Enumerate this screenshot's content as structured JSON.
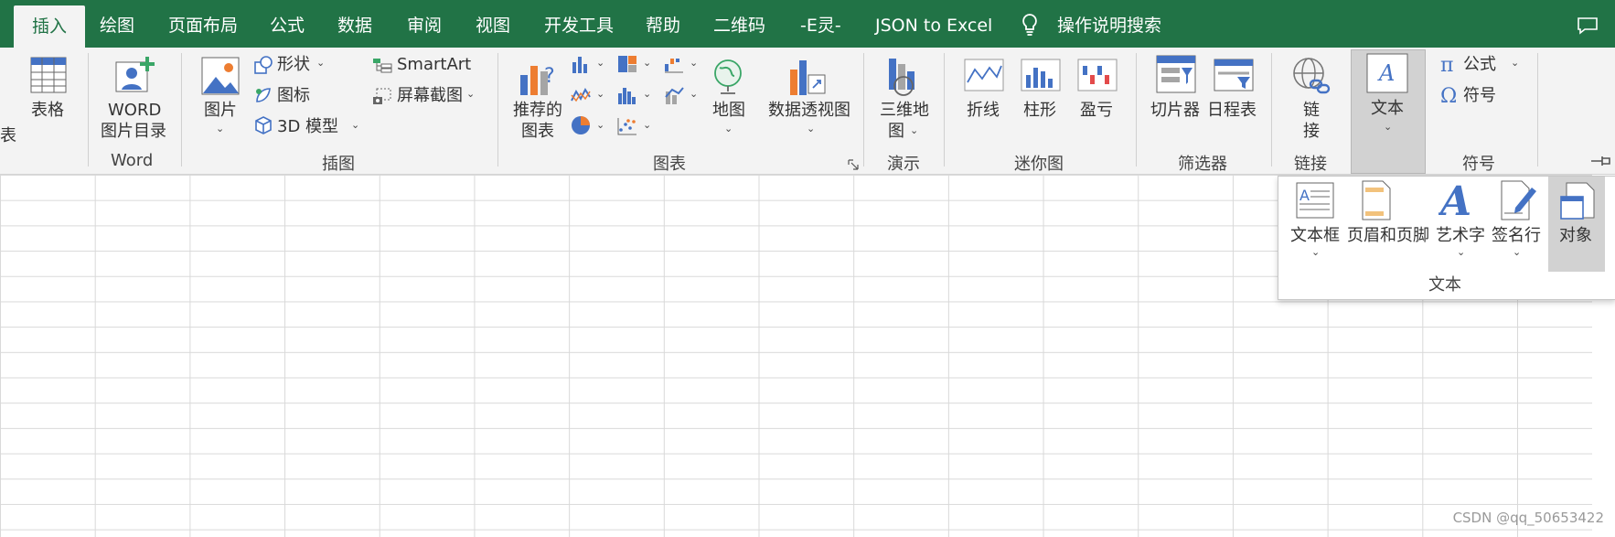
{
  "tabs": [
    "插入",
    "绘图",
    "页面布局",
    "公式",
    "数据",
    "审阅",
    "视图",
    "开发工具",
    "帮助",
    "二维码",
    "-E灵-",
    "JSON to Excel"
  ],
  "search": {
    "label": "操作说明搜索"
  },
  "ribbon": {
    "table_partial": "表",
    "table": "表格",
    "word_line1": "WORD",
    "word_line2": "图片目录",
    "group_word": "Word",
    "picture": "图片",
    "shapes": "形状",
    "icons": "图标",
    "model3d": "3D 模型",
    "smartart": "SmartArt",
    "screenshot": "屏幕截图",
    "group_illustrations": "插图",
    "rec_line1": "推荐的",
    "rec_line2": "图表",
    "map": "地图",
    "pivot": "数据透视图",
    "group_charts": "图表",
    "map3d_line1": "三维地",
    "map3d_line2": "图",
    "group_tours": "演示",
    "spark_line": "折线",
    "spark_column": "柱形",
    "spark_winloss": "盈亏",
    "group_sparklines": "迷你图",
    "slicer": "切片器",
    "timeline": "日程表",
    "group_filters": "筛选器",
    "link_line1": "链",
    "link_line2": "接",
    "group_links": "链接",
    "text": "文本",
    "equation": "公式",
    "symbol": "符号",
    "group_symbols": "符号"
  },
  "text_panel": {
    "textbox": "文本框",
    "header_footer": "页眉和页脚",
    "wordart": "艺术字",
    "signature": "签名行",
    "object": "对象",
    "group": "文本"
  },
  "colors": {
    "accent": "#217346",
    "ribbon_bg": "#f3f3f3",
    "chart_blue": "#4472c4",
    "chart_orange": "#ed7d31"
  },
  "watermark": "CSDN @qq_50653422"
}
